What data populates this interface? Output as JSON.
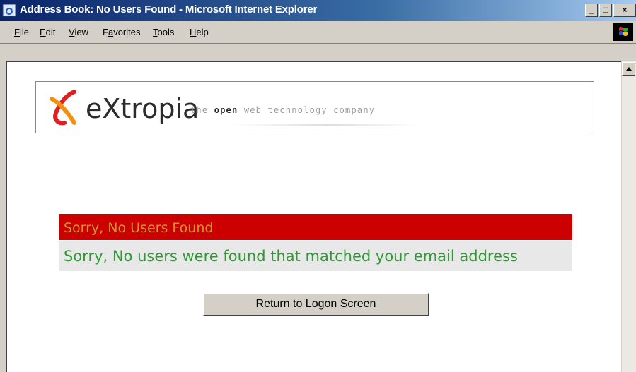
{
  "window": {
    "title": "Address Book: No Users Found - Microsoft Internet Explorer",
    "controls": {
      "minimize": "_",
      "maximize": "□",
      "close": "×"
    }
  },
  "menubar": {
    "items": [
      {
        "label": "File",
        "mnemonic": "F",
        "rest": "ile"
      },
      {
        "label": "Edit",
        "mnemonic": "E",
        "rest": "dit"
      },
      {
        "label": "View",
        "mnemonic": "V",
        "rest": "iew"
      },
      {
        "label": "Favorites",
        "pre": "F",
        "mnemonic": "a",
        "rest": "vorites"
      },
      {
        "label": "Tools",
        "mnemonic": "T",
        "rest": "ools"
      },
      {
        "label": "Help",
        "mnemonic": "H",
        "rest": "elp"
      }
    ]
  },
  "logo": {
    "brand": "eXtropia",
    "tagline_pre": "the ",
    "tagline_bold": "open",
    "tagline_post": " web technology company"
  },
  "error": {
    "header": "Sorry, No Users Found",
    "message": "Sorry, No users were found that matched your email address"
  },
  "actions": {
    "return_label": "Return to Logon Screen"
  },
  "colors": {
    "error_header_bg": "#cc0000",
    "error_header_text": "#c79a2e",
    "message_text": "#2e9a33",
    "titlebar": "#0a246a"
  }
}
